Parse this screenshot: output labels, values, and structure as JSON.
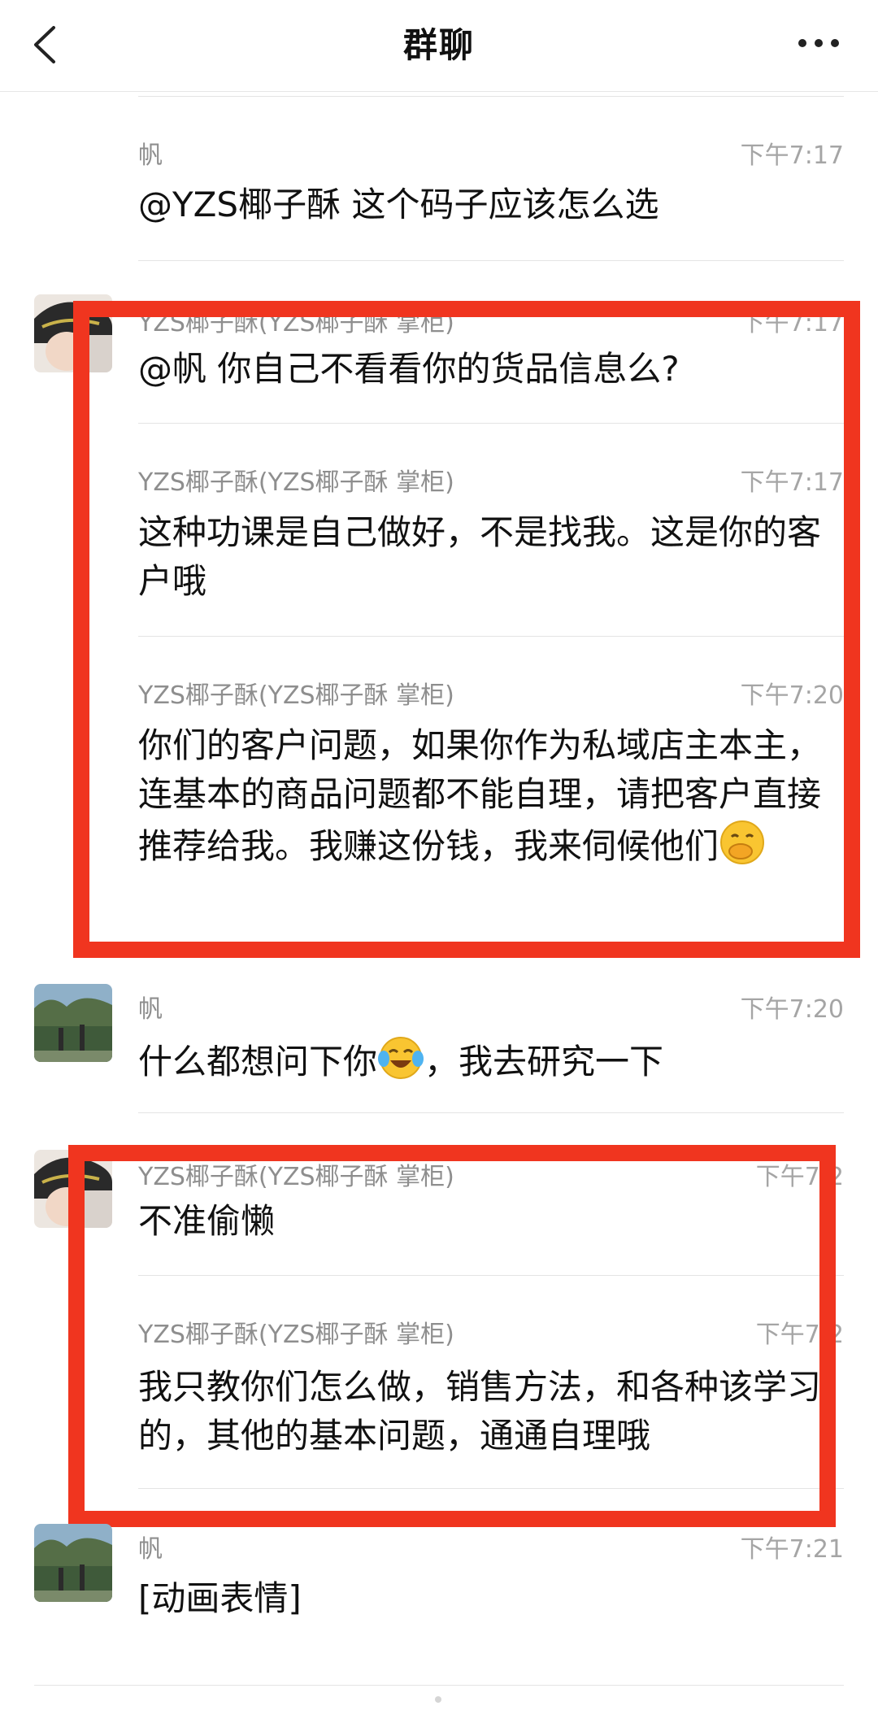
{
  "header": {
    "title": "群聊",
    "back_icon": "back-arrow-icon",
    "more_icon": "more-dots-icon"
  },
  "messages": [
    {
      "sender": "帆",
      "time": "下午7:17",
      "text": "@YZS椰子酥 这个码子应该怎么选"
    },
    {
      "sender": "YZS椰子酥(YZS椰子酥  掌柜)",
      "time": "下午7:17",
      "text": "@帆 你自己不看看你的货品信息么?"
    },
    {
      "sender": "YZS椰子酥(YZS椰子酥  掌柜)",
      "time": "下午7:17",
      "text": "这种功课是自己做好，不是找我。这是你的客户哦"
    },
    {
      "sender": "YZS椰子酥(YZS椰子酥  掌柜)",
      "time": "下午7:20",
      "text": "你们的客户问题，如果你作为私域店主本主，连基本的商品问题都不能自理，请把客户直接推荐给我。我赚这份钱，我来伺候他们",
      "emoji": "face-with-hand-over-mouth"
    },
    {
      "sender": "帆",
      "time": "下午7:20",
      "text_before": "什么都想问下你",
      "text_after": "，我去研究一下",
      "emoji": "tears-of-joy"
    },
    {
      "sender": "YZS椰子酥(YZS椰子酥  掌柜)",
      "time": "下午7:2",
      "text": "不准偷懒"
    },
    {
      "sender": "YZS椰子酥(YZS椰子酥  掌柜)",
      "time": "下午7:2",
      "text": "我只教你们怎么做，销售方法，和各种该学习的，其他的基本问题，通通自理哦"
    },
    {
      "sender": "帆",
      "time": "下午7:21",
      "text": "[动画表情]"
    }
  ],
  "colors": {
    "highlight": "#f0351f",
    "name": "#8e8e8e",
    "time": "#a5a5a5",
    "divider": "#e4e4e4"
  }
}
